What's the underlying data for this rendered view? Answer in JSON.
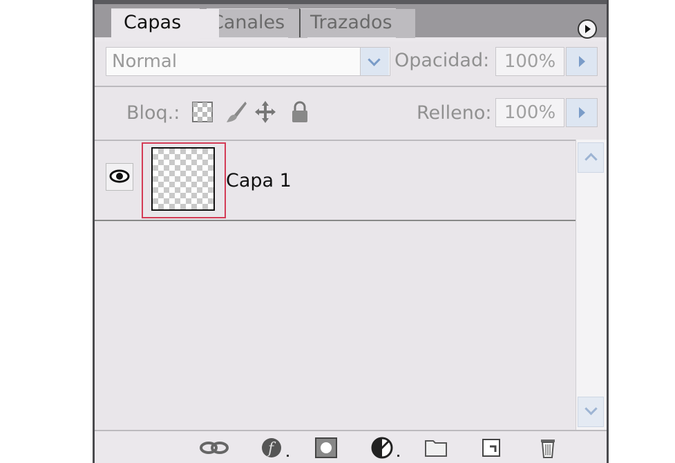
{
  "tabs": [
    {
      "label": "Capas",
      "active": true
    },
    {
      "label": "Canales",
      "active": false
    },
    {
      "label": "Trazados",
      "active": false
    }
  ],
  "panel_menu_icon": "circle-arrow-right-icon",
  "blend_mode": {
    "value": "Normal"
  },
  "opacity": {
    "label": "Opacidad:",
    "value": "100%"
  },
  "lock": {
    "label": "Bloq.:",
    "icons": [
      "lock-transparency-icon",
      "lock-paint-icon",
      "lock-move-icon",
      "lock-all-icon"
    ]
  },
  "fill": {
    "label": "Relleno:",
    "value": "100%"
  },
  "layers": [
    {
      "name": "Capa 1",
      "visible": true,
      "selected": true
    }
  ],
  "bottom_icons": [
    "link-layers-icon",
    "layer-style-icon",
    "layer-mask-icon",
    "adjustment-layer-icon",
    "new-group-icon",
    "new-layer-icon",
    "delete-layer-icon"
  ],
  "colors": {
    "panel_bg": "#e9e6ea",
    "selection_outline": "#d33a55",
    "accent_blue": "#7a9cc8"
  }
}
